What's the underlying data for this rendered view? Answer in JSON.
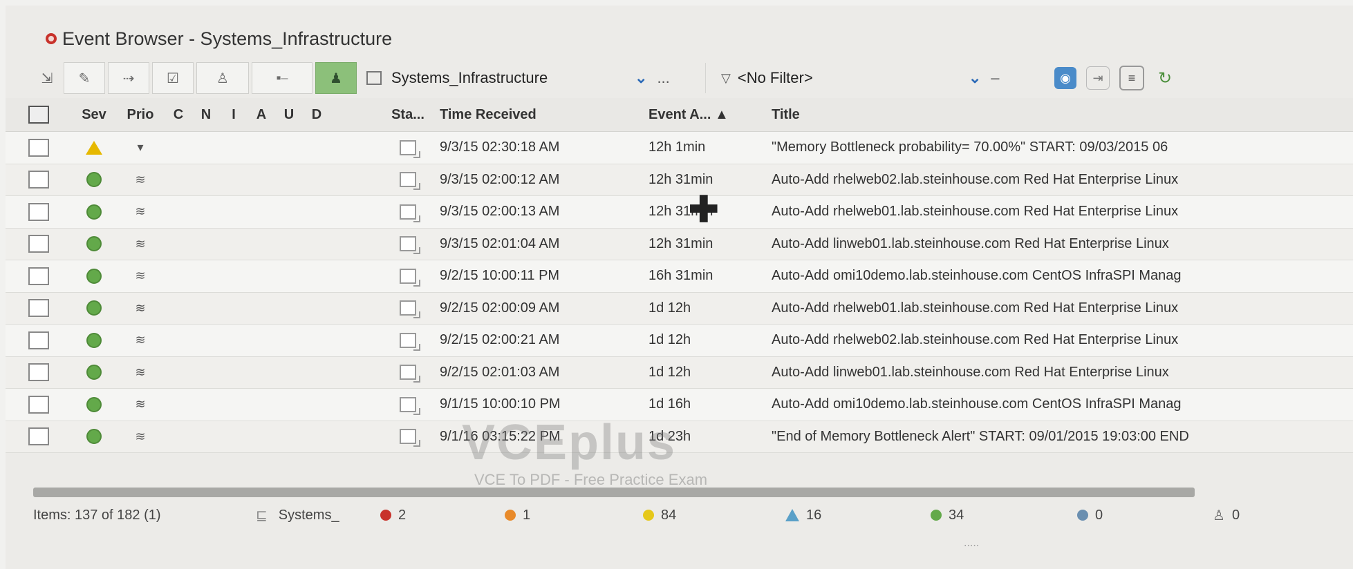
{
  "window": {
    "title": "Event Browser - Systems_Infrastructure"
  },
  "toolbar": {
    "view_name": "Systems_Infrastructure",
    "view_more": "...",
    "filter_name": "<No Filter>",
    "filter_more": "–"
  },
  "columns": {
    "sev": "Sev",
    "pri": "Prio",
    "flags": [
      "C",
      "N",
      "I",
      "A",
      "U",
      "D"
    ],
    "state": "Sta...",
    "time": "Time Received",
    "age": "Event A...",
    "title": "Title"
  },
  "rows": [
    {
      "severity": "warning",
      "time": "9/3/15 02:30:18 AM",
      "age": "12h 1min",
      "title": "\"Memory Bottleneck probability=   70.00%\" START: 09/03/2015 06"
    },
    {
      "severity": "normal",
      "time": "9/3/15 02:00:12 AM",
      "age": "12h 31min",
      "title": "Auto-Add rhelweb02.lab.steinhouse.com Red Hat Enterprise Linux"
    },
    {
      "severity": "normal",
      "time": "9/3/15 02:00:13 AM",
      "age": "12h 31min",
      "title": "Auto-Add rhelweb01.lab.steinhouse.com Red Hat Enterprise Linux"
    },
    {
      "severity": "normal",
      "time": "9/3/15 02:01:04 AM",
      "age": "12h 31min",
      "title": "Auto-Add linweb01.lab.steinhouse.com Red Hat Enterprise Linux"
    },
    {
      "severity": "normal",
      "time": "9/2/15 10:00:11 PM",
      "age": "16h 31min",
      "title": "Auto-Add omi10demo.lab.steinhouse.com CentOS InfraSPI Manag"
    },
    {
      "severity": "normal",
      "time": "9/2/15 02:00:09 AM",
      "age": "1d 12h",
      "title": "Auto-Add rhelweb01.lab.steinhouse.com Red Hat Enterprise Linux"
    },
    {
      "severity": "normal",
      "time": "9/2/15 02:00:21 AM",
      "age": "1d 12h",
      "title": "Auto-Add rhelweb02.lab.steinhouse.com Red Hat Enterprise Linux"
    },
    {
      "severity": "normal",
      "time": "9/2/15 02:01:03 AM",
      "age": "1d 12h",
      "title": "Auto-Add linweb01.lab.steinhouse.com Red Hat Enterprise Linux"
    },
    {
      "severity": "normal",
      "time": "9/1/15 10:00:10 PM",
      "age": "1d 16h",
      "title": "Auto-Add omi10demo.lab.steinhouse.com CentOS InfraSPI Manag"
    },
    {
      "severity": "normal",
      "time": "9/1/16 03:15:22 PM",
      "age": "1d 23h",
      "title": "\"End of Memory Bottleneck Alert\" START: 09/01/2015 19:03:00 END"
    }
  ],
  "status": {
    "items": "Items: 137 of 182 (1)",
    "view": "Systems_",
    "critical": "2",
    "major": "1",
    "minor": "84",
    "warning": "16",
    "normal": "34",
    "unknown": "0",
    "assigned": "0"
  },
  "watermark": {
    "main": "VCEplus",
    "sub": "VCE To PDF - Free Practice Exam"
  },
  "colors": {
    "normal": "#63a94a",
    "warning": "#e6b800",
    "critical": "#c8322b",
    "toolbar_active": "#8cc07a"
  }
}
